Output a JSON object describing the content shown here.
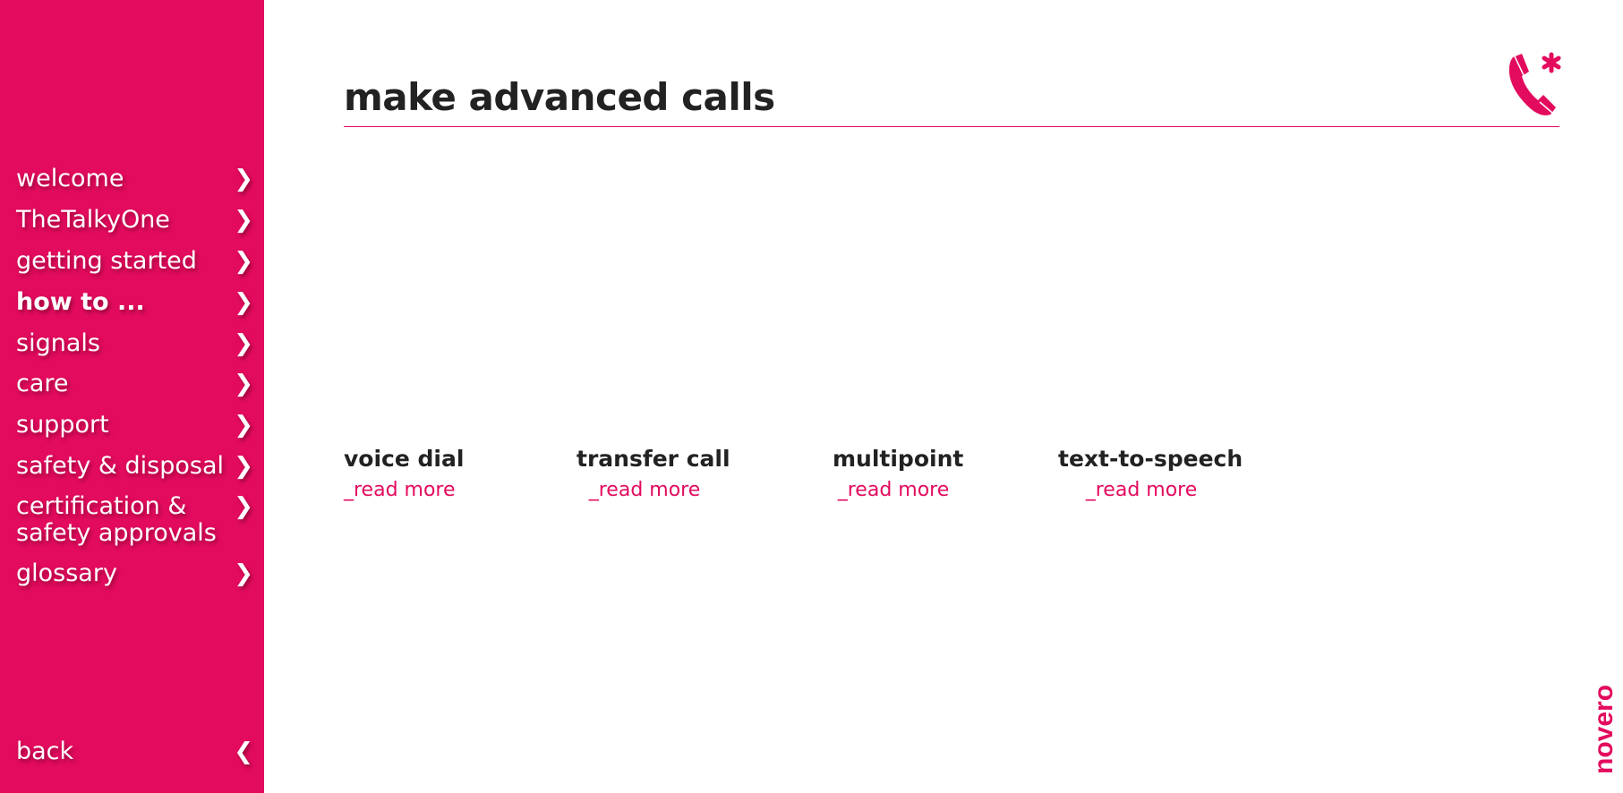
{
  "sidebar": {
    "items": [
      {
        "label": "welcome"
      },
      {
        "label": "TheTalkyOne"
      },
      {
        "label": "getting started"
      },
      {
        "label": "how to ..."
      },
      {
        "label": "signals"
      },
      {
        "label": "care"
      },
      {
        "label": "support"
      },
      {
        "label": "safety & disposal"
      },
      {
        "label": "certification & safety approvals"
      },
      {
        "label": "glossary"
      }
    ],
    "active": "how to ...",
    "back": "back",
    "chevron_right": "›",
    "chevron_left": "«"
  },
  "header": {
    "title": "make advanced calls",
    "icon": "phone-asterisk-icon"
  },
  "features": [
    {
      "name": "voice dial",
      "link": "_read more"
    },
    {
      "name": "transfer call",
      "link": "_read more"
    },
    {
      "name": "multipoint",
      "link": "_read more"
    },
    {
      "name": "text-to-speech",
      "link": "_read more"
    }
  ],
  "brand": {
    "logo": "novero",
    "color": "#e30b5e"
  }
}
